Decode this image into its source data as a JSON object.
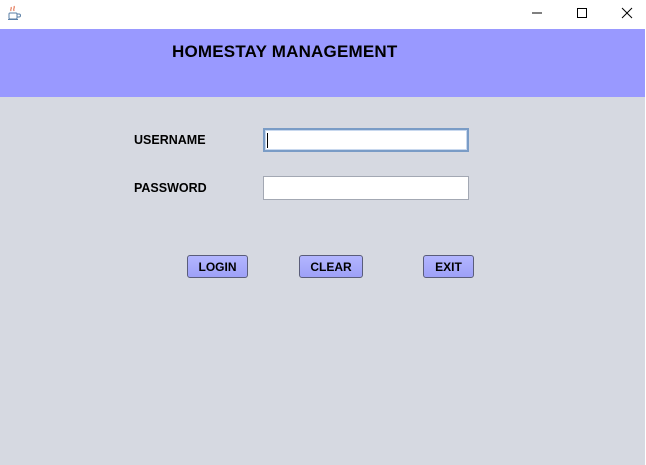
{
  "window": {
    "minimize_glyph": "—",
    "maximize_glyph": "☐",
    "close_glyph": "✕"
  },
  "header": {
    "title": "HOMESTAY MANAGEMENT",
    "background": "#9999ff"
  },
  "form": {
    "username_label": "USERNAME",
    "username_value": "",
    "password_label": "PASSWORD",
    "password_value": ""
  },
  "buttons": {
    "login_label": "LOGIN",
    "clear_label": "CLEAR",
    "exit_label": "EXIT",
    "color": "#a5a8fb"
  },
  "icons": {
    "app": "java-cup-icon",
    "minimize": "minimize-icon",
    "maximize": "maximize-icon",
    "close": "close-icon"
  }
}
